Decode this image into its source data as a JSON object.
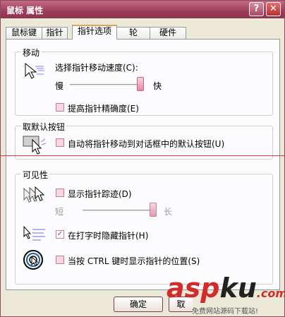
{
  "window": {
    "title": "鼠标 属性",
    "help_glyph": "?",
    "close_glyph": "✕"
  },
  "tabs": [
    {
      "label": "鼠标键",
      "active": false
    },
    {
      "label": "指针",
      "active": false
    },
    {
      "label": "指针选项",
      "active": true
    },
    {
      "label": "轮",
      "active": false
    },
    {
      "label": "硬件",
      "active": false
    }
  ],
  "motion": {
    "group_label": "移动",
    "speed_label": "选择指针移动速度(C):",
    "slow": "慢",
    "fast": "快",
    "speed_level": 0.98,
    "precision_label": "提高指针精确度(E)",
    "precision_checked": false
  },
  "snapto": {
    "group_label": "取默认按钮",
    "label": "自动将指针移动到对话框中的默认按钮(U)",
    "checked": false
  },
  "visibility": {
    "group_label": "可见性",
    "trails_label": "显示指针踪迹(D)",
    "trails_checked": false,
    "short": "短",
    "long": "长",
    "trails_level": 0.98,
    "hide_label": "在打字时隐藏指针(H)",
    "hide_checked": true,
    "show_ctrl_label": "当按 CTRL 键时显示指针的位置(S)",
    "show_ctrl_checked": false
  },
  "buttons": {
    "ok": "确定",
    "cancel": "取"
  },
  "watermark": {
    "brand_a": "asp",
    "brand_b": "ku",
    "brand_c": ".com",
    "tagline": "免费网站源码下载站!"
  },
  "colors": {
    "titlebar": "#9c3c58",
    "checkbox": "#f7d6e0",
    "accent_red": "#e23a3a"
  }
}
